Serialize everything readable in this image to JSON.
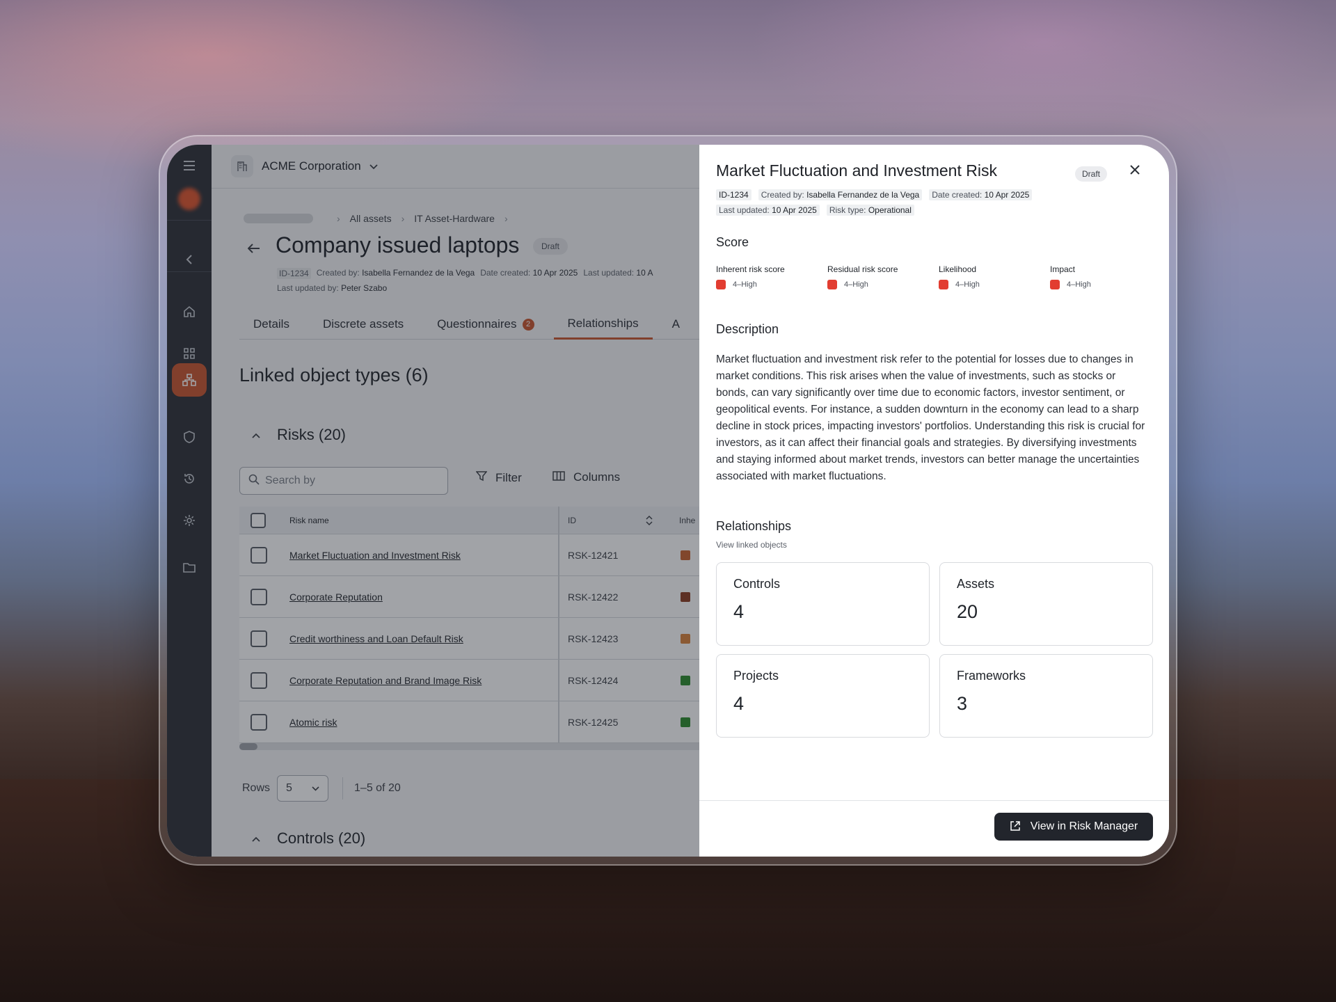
{
  "org": {
    "name": "ACME Corporation"
  },
  "breadcrumbs": [
    "All assets",
    "IT Asset-Hardware"
  ],
  "page": {
    "title": "Company issued laptops",
    "status": "Draft",
    "meta": {
      "id": "ID-1234",
      "created_by_label": "Created by:",
      "created_by": "Isabella Fernandez de la Vega",
      "date_created_label": "Date created:",
      "date_created": "10 Apr 2025",
      "last_updated_label": "Last updated:",
      "last_updated": "10 A",
      "last_updated_by_label": "Last updated by:",
      "last_updated_by": "Peter Szabo"
    }
  },
  "tabs": [
    {
      "label": "Details"
    },
    {
      "label": "Discrete assets"
    },
    {
      "label": "Questionnaires",
      "badge": "2"
    },
    {
      "label": "Relationships"
    },
    {
      "label": "A"
    }
  ],
  "linked": {
    "heading": "Linked object types (6)"
  },
  "risks": {
    "heading": "Risks (20)",
    "search_placeholder": "Search by",
    "filter_label": "Filter",
    "columns_label": "Columns",
    "columns": [
      "Risk name",
      "ID",
      "Inhe"
    ],
    "rows": [
      {
        "name": "Market Fluctuation and Investment Risk",
        "id": "RSK-12421",
        "color": "#c8612b"
      },
      {
        "name": "Corporate Reputation",
        "id": "RSK-12422",
        "color": "#8a3a1e"
      },
      {
        "name": "Credit worthiness and Loan Default Risk",
        "id": "RSK-12423",
        "color": "#d9823a"
      },
      {
        "name": "Corporate Reputation and Brand Image Risk",
        "id": "RSK-12424",
        "color": "#2a8a2a"
      },
      {
        "name": "Atomic risk",
        "id": "RSK-12425",
        "color": "#2a8a2a"
      }
    ],
    "rows_label": "Rows",
    "rows_value": "5",
    "range": "1–5 of 20"
  },
  "controls": {
    "heading": "Controls (20)"
  },
  "panel": {
    "title": "Market Fluctuation and Investment Risk",
    "status": "Draft",
    "meta": {
      "id": "ID-1234",
      "created_by_label": "Created by:",
      "created_by": "Isabella Fernandez de la Vega",
      "date_created_label": "Date created:",
      "date_created": "10 Apr 2025",
      "last_updated_label": "Last updated:",
      "last_updated": "10 Apr 2025",
      "risk_type_label": "Risk type:",
      "risk_type": "Operational"
    },
    "score_heading": "Score",
    "scores": [
      {
        "label": "Inherent risk score",
        "value": "4–High"
      },
      {
        "label": "Residual risk score",
        "value": "4–High"
      },
      {
        "label": "Likelihood",
        "value": "4–High"
      },
      {
        "label": "Impact",
        "value": "4–High"
      }
    ],
    "description_heading": "Description",
    "description": "Market fluctuation and investment risk refer to the potential for losses due to changes in market conditions. This risk arises when the value of investments, such as stocks or bonds, can vary significantly over time due to economic factors, investor sentiment, or geopolitical events. For instance, a sudden downturn in the economy can lead to a sharp decline in stock prices, impacting investors' portfolios. Understanding this risk is crucial for investors, as it can affect their financial goals and strategies. By diversifying investments and staying informed about market trends, investors can better manage the uncertainties associated with market fluctuations.",
    "relationships_heading": "Relationships",
    "relationships_sub": "View linked objects",
    "cards": [
      {
        "label": "Controls",
        "value": "4"
      },
      {
        "label": "Assets",
        "value": "20"
      },
      {
        "label": "Projects",
        "value": "4"
      },
      {
        "label": "Frameworks",
        "value": "3"
      }
    ],
    "cta": "View in Risk Manager",
    "score_color": "#e23d31"
  }
}
